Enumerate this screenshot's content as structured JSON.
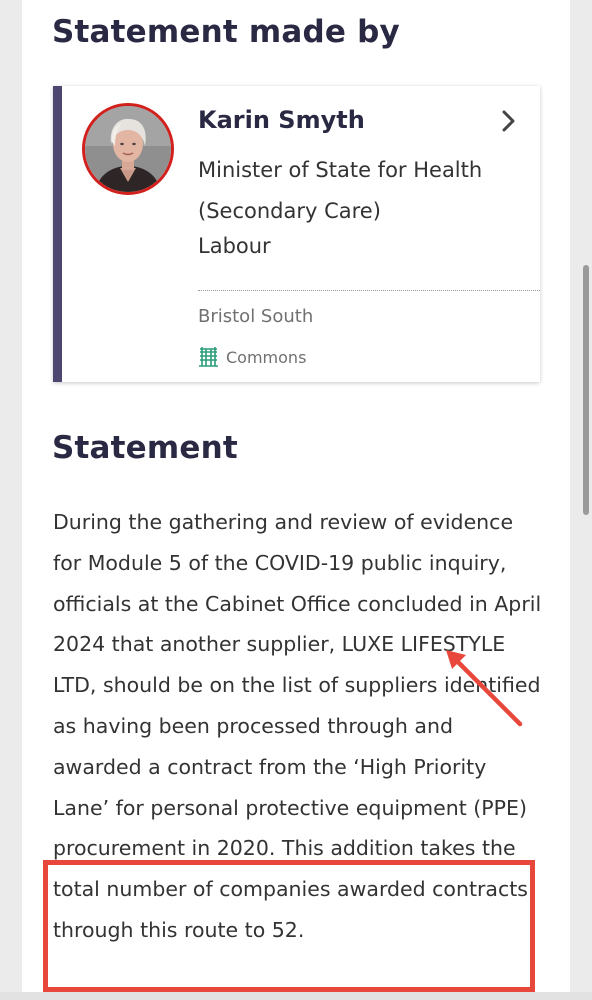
{
  "section_made_by": {
    "title": "Statement made by"
  },
  "member": {
    "name": "Karin Smyth",
    "role": "Minister of State for Health (Secondary Care)",
    "party": "Labour",
    "constituency": "Bristol South",
    "house": "Commons",
    "icons": {
      "open": "chevron-right-icon",
      "house": "portcullis-icon"
    },
    "colors": {
      "accent": "#4c4670",
      "party_ring": "#d2201c",
      "house_icon": "#2a9d79"
    }
  },
  "section_statement": {
    "title": "Statement"
  },
  "statement": {
    "text": "During the gathering and review of evidence for Module 5 of the COVID-19 public inquiry, officials at the Cabinet Office concluded in April 2024 that another supplier, LUXE LIFESTYLE LTD, should be on the list of suppliers identified as having been processed through and awarded a contract from the ‘High Priority Lane’ for personal protective equipment (PPE) procurement in 2020. This addition takes the total number of companies awarded contracts through this route to 52."
  },
  "annotations": {
    "color": "#e8483b",
    "arrow_target": "LUXE LIFESTYLE LTD",
    "highlighted_text": "2020. This addition takes the total number of companies awarded contracts through this route to 52."
  }
}
